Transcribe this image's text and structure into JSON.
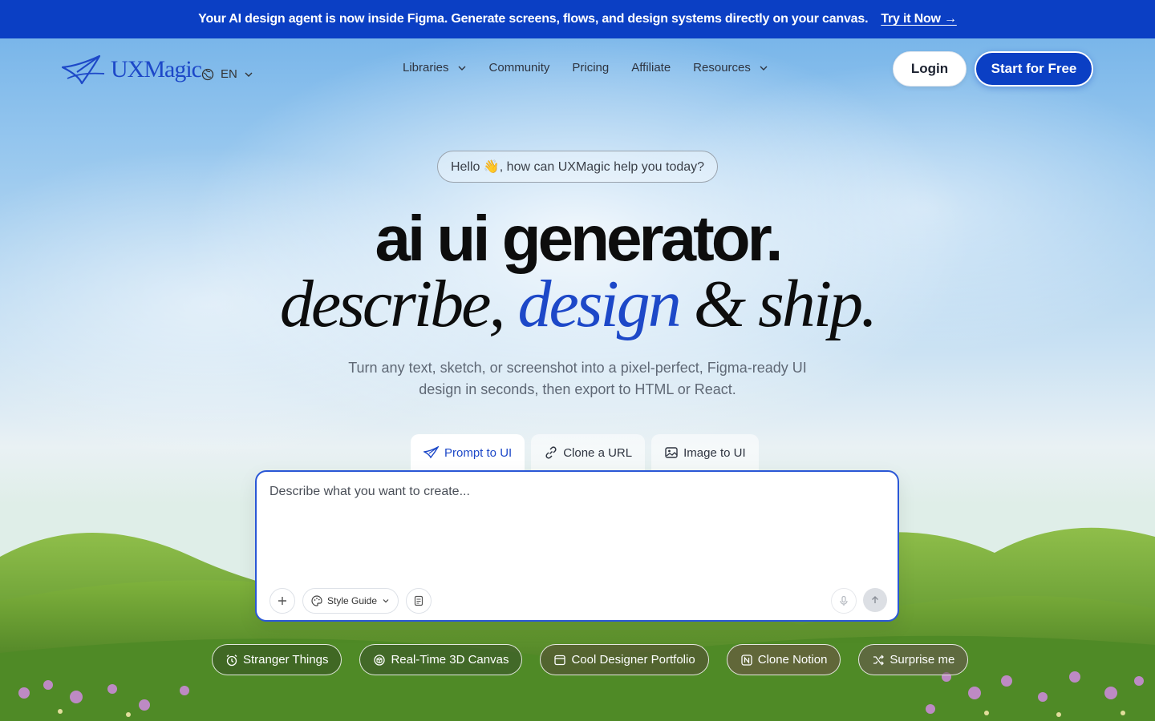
{
  "announcement": {
    "text": "Your AI design agent is now inside Figma. Generate screens, flows, and design systems directly on your canvas.",
    "link": "Try it Now →"
  },
  "nav": {
    "logo": "UXMagic",
    "language": "EN",
    "menu": [
      {
        "label": "Libraries",
        "dropdown": true
      },
      {
        "label": "Community",
        "dropdown": false
      },
      {
        "label": "Pricing",
        "dropdown": false
      },
      {
        "label": "Affiliate",
        "dropdown": false
      },
      {
        "label": "Resources",
        "dropdown": true
      }
    ],
    "login": "Login",
    "start": "Start for Free"
  },
  "hero": {
    "greeting": "Hello 👋, how can UXMagic help you today?",
    "title": "ai ui generator.",
    "subtitle_part1": "describe,",
    "subtitle_accent": "design",
    "subtitle_part2": "& ship.",
    "description": "Turn any text, sketch, or screenshot into a pixel-perfect, Figma-ready UI design in seconds, then export to HTML or React."
  },
  "tabs": [
    {
      "label": "Prompt to UI",
      "icon": "plane-icon",
      "active": true
    },
    {
      "label": "Clone a URL",
      "icon": "link-icon",
      "active": false
    },
    {
      "label": "Image to UI",
      "icon": "image-icon",
      "active": false
    }
  ],
  "prompt": {
    "placeholder": "Describe what you want to create...",
    "style_guide": "Style Guide"
  },
  "chips": [
    {
      "label": "Stranger Things",
      "icon": "alarm-icon"
    },
    {
      "label": "Real-Time 3D Canvas",
      "icon": "cube-icon"
    },
    {
      "label": "Cool Designer Portfolio",
      "icon": "browser-icon"
    },
    {
      "label": "Clone Notion",
      "icon": "notion-icon"
    },
    {
      "label": "Surprise me",
      "icon": "shuffle-icon"
    }
  ],
  "colors": {
    "brand": "#0b3fc4",
    "accent": "#1d48c8",
    "text": "#0d0d0d"
  }
}
